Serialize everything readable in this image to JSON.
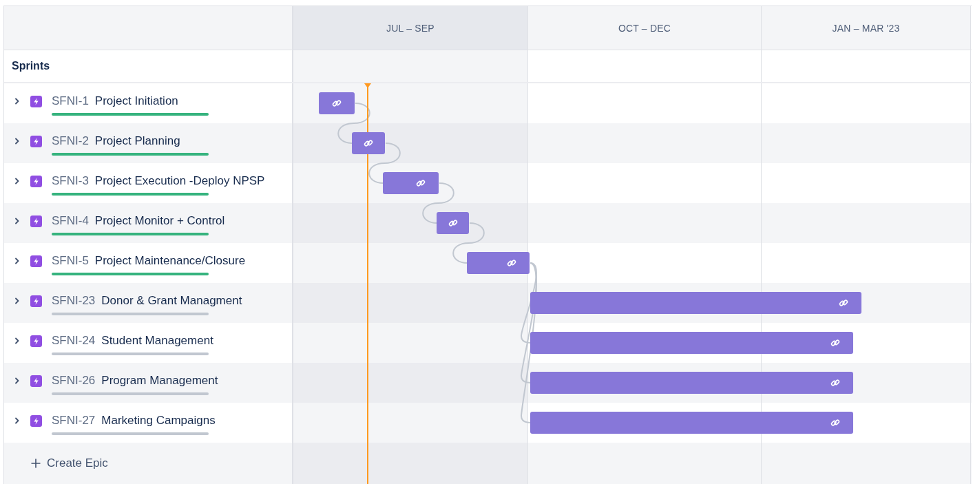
{
  "timeline": {
    "columns": [
      {
        "label": "JUL – SEP",
        "current": true
      },
      {
        "label": "OCT – DEC",
        "current": false
      },
      {
        "label": "JAN – MAR '23",
        "current": false
      }
    ]
  },
  "section": {
    "label": "Sprints"
  },
  "epics": [
    {
      "key": "SFNI-1",
      "title": "Project Initiation",
      "expanded": false,
      "done": true
    },
    {
      "key": "SFNI-2",
      "title": "Project Planning",
      "expanded": false,
      "done": true
    },
    {
      "key": "SFNI-3",
      "title": "Project Execution -Deploy NPSP",
      "expanded": false,
      "done": true
    },
    {
      "key": "SFNI-4",
      "title": "Project Monitor + Control",
      "expanded": false,
      "done": true
    },
    {
      "key": "SFNI-5",
      "title": "Project Maintenance/Closure",
      "expanded": false,
      "done": true
    },
    {
      "key": "SFNI-23",
      "title": "Donor & Grant Managment",
      "expanded": false,
      "done": false
    },
    {
      "key": "SFNI-24",
      "title": "Student Management",
      "expanded": false,
      "done": false
    },
    {
      "key": "SFNI-26",
      "title": "Program Management",
      "expanded": false,
      "done": false
    },
    {
      "key": "SFNI-27",
      "title": "Marketing Campaigns",
      "expanded": false,
      "done": false
    }
  ],
  "create": {
    "label": "Create Epic"
  }
}
